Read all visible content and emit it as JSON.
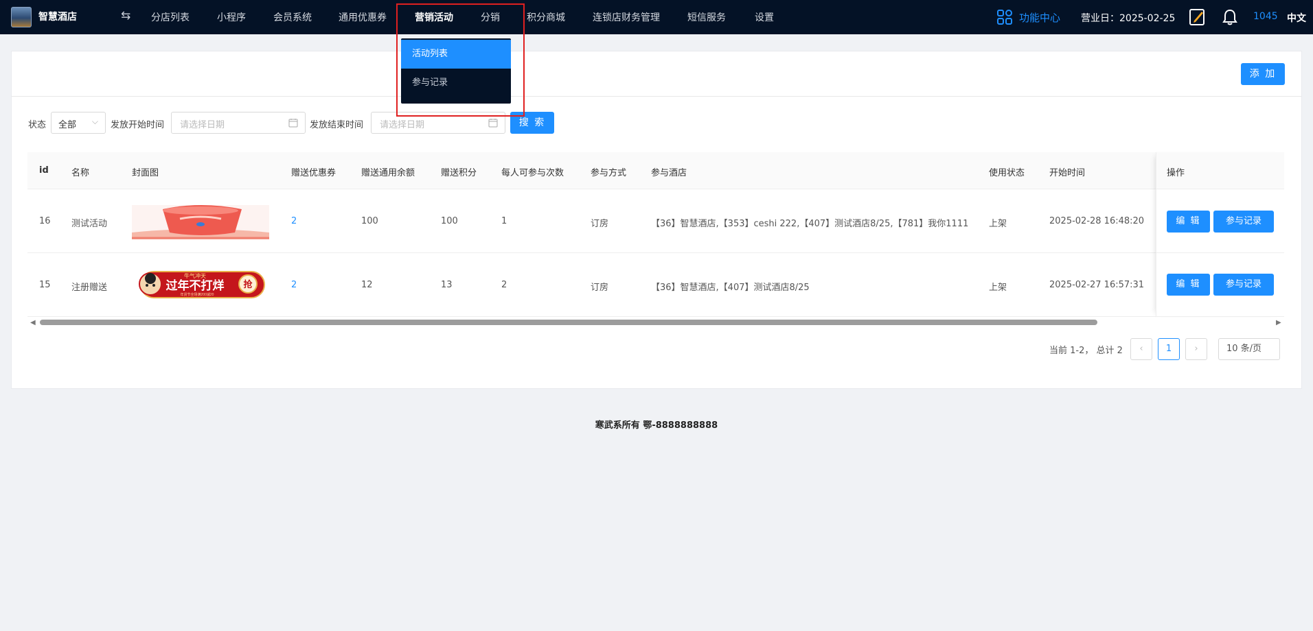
{
  "brand": {
    "name": "智慧酒店"
  },
  "nav": {
    "swap_icon": "swap-icon",
    "items": [
      "分店列表",
      "小程序",
      "会员系统",
      "通用优惠券",
      "营销活动",
      "分销",
      "积分商城",
      "连锁店财务管理",
      "短信服务",
      "设置"
    ],
    "active": "营销活动"
  },
  "header_right": {
    "function_center": "功能中心",
    "business_date": "营业日：2025-02-25",
    "user_number": "1045",
    "language": "中文"
  },
  "dropdown": {
    "items": [
      "活动列表",
      "参与记录"
    ],
    "selected": "活动列表"
  },
  "toolbar": {
    "add_label": "添 加"
  },
  "filters": {
    "status_label": "状态",
    "status_value": "全部",
    "start_label": "发放开始时间",
    "start_placeholder": "请选择日期",
    "end_label": "发放结束时间",
    "end_placeholder": "请选择日期",
    "search_label": "搜 索"
  },
  "table": {
    "columns": [
      "id",
      "名称",
      "封面图",
      "赠送优惠券",
      "赠送通用余额",
      "赠送积分",
      "每人可参与次数",
      "参与方式",
      "参与酒店",
      "使用状态",
      "开始时间",
      "操作"
    ],
    "rows": [
      {
        "id": "16",
        "name": "测试活动",
        "coupons": "2",
        "balance": "100",
        "points": "100",
        "times": "1",
        "method": "订房",
        "hotels": "【36】智慧酒店,【353】ceshi 222,【407】测试酒店8/25,【781】我你1111",
        "status": "上架",
        "start_time": "2025-02-28 16:48:20"
      },
      {
        "id": "15",
        "name": "注册赠送",
        "coupons": "2",
        "balance": "12",
        "points": "13",
        "times": "2",
        "method": "订房",
        "hotels": "【36】智慧酒店,【407】测试酒店8/25",
        "status": "上架",
        "start_time": "2025-02-27 16:57:31"
      }
    ],
    "row_actions": {
      "edit": "编 辑",
      "records": "参与记录"
    },
    "banner": {
      "top_text": "牛气冲天",
      "main_text": "过年不打烊",
      "badge": "抢",
      "small_text": "年货节全场满200减20"
    }
  },
  "pagination": {
    "info": "当前 1-2， 总计 2",
    "current_page": "1",
    "page_size": "10 条/页"
  },
  "footer": {
    "text": "寒武系所有 鄂-8888888888"
  },
  "colors": {
    "topbar": "#041226",
    "accent": "#1e8fff",
    "highlight": "#e02020"
  }
}
